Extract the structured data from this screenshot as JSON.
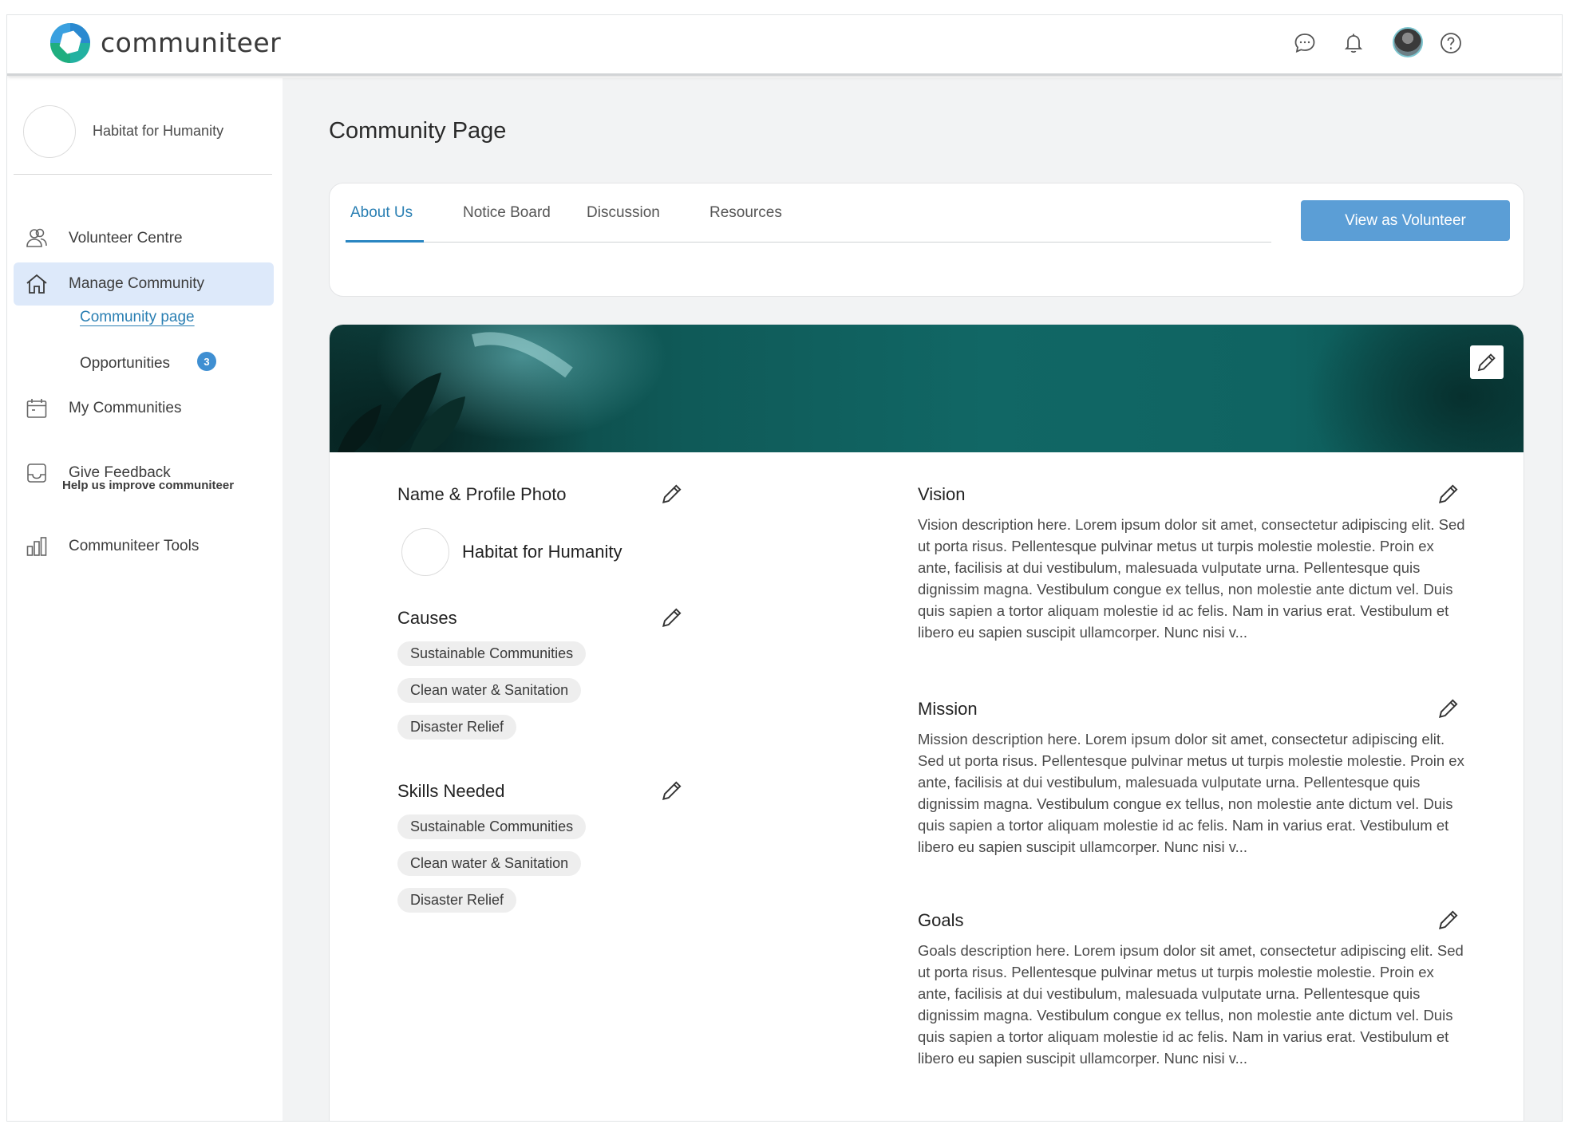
{
  "header": {
    "brand": "communiteer",
    "icons": [
      "chat-icon",
      "bell-icon",
      "avatar",
      "help-icon"
    ]
  },
  "sidebar": {
    "org_name": "Habitat for Humanity",
    "items": [
      {
        "label": "Volunteer Centre",
        "icon": "users-icon"
      },
      {
        "label": "Manage Community",
        "icon": "home-icon",
        "active": true
      },
      {
        "label": "My Communities",
        "icon": "calendar-icon"
      },
      {
        "label": "Give Feedback",
        "sub": "Help us improve communiteer",
        "icon": "inbox-icon"
      },
      {
        "label": "Communiteer Tools",
        "icon": "chart-icon"
      }
    ],
    "subitems": [
      {
        "label": "Community page",
        "active": true
      },
      {
        "label": "Opportunities",
        "badge": "3"
      }
    ]
  },
  "main": {
    "title": "Community Page",
    "tabs": [
      {
        "label": "About Us",
        "active": true
      },
      {
        "label": "Notice Board"
      },
      {
        "label": "Discussion"
      },
      {
        "label": "Resources"
      }
    ],
    "view_button": "View as Volunteer",
    "profile": {
      "title": "Name & Profile Photo",
      "name": "Habitat for Humanity"
    },
    "causes": {
      "title": "Causes",
      "chips": [
        "Sustainable Communities",
        "Clean water & Sanitation",
        "Disaster Relief"
      ]
    },
    "skills": {
      "title": "Skills Needed",
      "chips": [
        "Sustainable Communities",
        "Clean water & Sanitation",
        "Disaster Relief"
      ]
    },
    "vision": {
      "title": "Vision",
      "text": "Vision description here. Lorem ipsum dolor sit amet, consectetur adipiscing elit. Sed ut porta risus. Pellentesque pulvinar metus ut turpis molestie molestie. Proin ex ante, facilisis at dui vestibulum, malesuada vulputate urna. Pellentesque quis dignissim magna. Vestibulum congue ex tellus, non molestie ante dictum vel. Duis quis sapien a tortor aliquam molestie id ac felis. Nam in varius erat. Vestibulum et libero eu sapien suscipit ullamcorper. Nunc nisi v..."
    },
    "mission": {
      "title": "Mission",
      "text": "Mission description here. Lorem ipsum dolor sit amet, consectetur adipiscing elit. Sed ut porta risus. Pellentesque pulvinar metus ut turpis molestie molestie. Proin ex ante, facilisis at dui vestibulum, malesuada vulputate urna. Pellentesque quis dignissim magna. Vestibulum congue ex tellus, non molestie ante dictum vel. Duis quis sapien a tortor aliquam molestie id ac felis. Nam in varius erat. Vestibulum et libero eu sapien suscipit ullamcorper. Nunc nisi v..."
    },
    "goals": {
      "title": "Goals",
      "text": "Goals description here. Lorem ipsum dolor sit amet, consectetur adipiscing elit. Sed ut porta risus. Pellentesque pulvinar metus ut turpis molestie molestie. Proin ex ante, facilisis at dui vestibulum, malesuada vulputate urna. Pellentesque quis dignissim magna. Vestibulum congue ex tellus, non molestie ante dictum vel. Duis quis sapien a tortor aliquam molestie id ac felis. Nam in varius erat. Vestibulum et libero eu sapien suscipit ullamcorper. Nunc nisi v..."
    }
  },
  "colors": {
    "accent": "#2a7fb3",
    "button": "#5b9ed6",
    "active_nav_bg": "#dde9fa",
    "badge": "#3f8fd2",
    "banner": "#116765"
  }
}
